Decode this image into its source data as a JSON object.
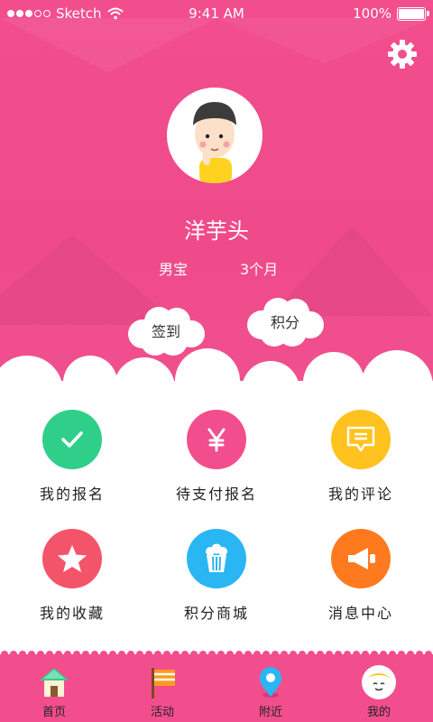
{
  "status_bar": {
    "carrier": "Sketch",
    "time": "9:41 AM",
    "battery": "100%",
    "battery_level": 1.0
  },
  "profile": {
    "name": "洋芋头",
    "gender": "男宝",
    "age": "3个月"
  },
  "actions": {
    "checkin": "签到",
    "points": "积分"
  },
  "grid": [
    {
      "label": "我的报名",
      "icon": "check-icon",
      "color": "#2fcf8a"
    },
    {
      "label": "待支付报名",
      "icon": "yen-icon",
      "color": "#f24e8e"
    },
    {
      "label": "我的评论",
      "icon": "comment-icon",
      "color": "#ffc21e"
    },
    {
      "label": "我的收藏",
      "icon": "star-icon",
      "color": "#f4546a"
    },
    {
      "label": "积分商城",
      "icon": "popcorn-icon",
      "color": "#29b6f2"
    },
    {
      "label": "消息中心",
      "icon": "megaphone-icon",
      "color": "#ff7a1e"
    }
  ],
  "tabs": [
    {
      "label": "首页",
      "icon": "house-icon"
    },
    {
      "label": "活动",
      "icon": "flag-icon"
    },
    {
      "label": "附近",
      "icon": "location-pin-icon"
    },
    {
      "label": "我的",
      "icon": "profile-face-icon",
      "active": true
    }
  ],
  "colors": {
    "brand_pink": "#f24e8e",
    "background": "#ffffff"
  }
}
